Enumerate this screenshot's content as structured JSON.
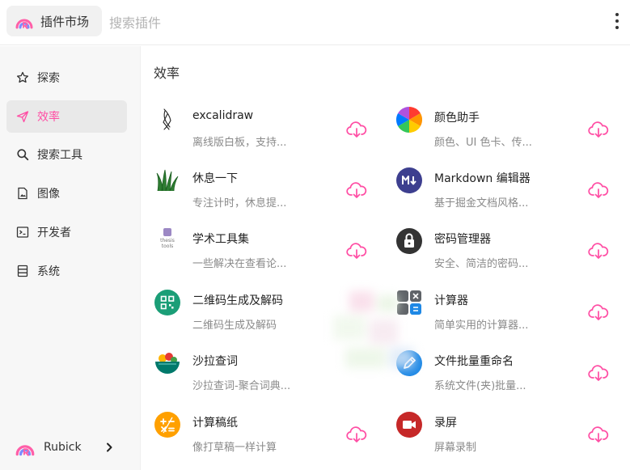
{
  "header": {
    "brand_label": "插件市场",
    "search_placeholder": "搜索插件"
  },
  "sidebar": {
    "items": [
      {
        "label": "探索",
        "icon": "star-icon"
      },
      {
        "label": "效率",
        "icon": "send-icon",
        "active": true
      },
      {
        "label": "搜索工具",
        "icon": "search-icon"
      },
      {
        "label": "图像",
        "icon": "image-file-icon"
      },
      {
        "label": "开发者",
        "icon": "terminal-icon"
      },
      {
        "label": "系统",
        "icon": "system-icon"
      }
    ],
    "user": {
      "name": "Rubick"
    }
  },
  "main": {
    "section_title": "效率",
    "plugins": [
      {
        "name": "excalidraw",
        "desc": "离线版白板，支持...",
        "icon": "excalidraw-icon"
      },
      {
        "name": "颜色助手",
        "desc": "颜色、UI 色卡、传...",
        "icon": "color-wheel-icon"
      },
      {
        "name": "休息一下",
        "desc": "专注计时，休息提...",
        "icon": "grass-icon"
      },
      {
        "name": "Markdown 编辑器",
        "desc": "基于掘金文档风格...",
        "icon": "markdown-icon"
      },
      {
        "name": "学术工具集",
        "desc": "一些解决在查看论...",
        "icon": "thesis-tools-icon",
        "icon_text_1": "thesis",
        "icon_text_2": "tools"
      },
      {
        "name": "密码管理器",
        "desc": "安全、简洁的密码...",
        "icon": "lock-icon"
      },
      {
        "name": "二维码生成及解码",
        "desc": "二维码生成及解码",
        "icon": "qrcode-icon"
      },
      {
        "name": "计算器",
        "desc": "简单实用的计算器...",
        "icon": "calculator-icon"
      },
      {
        "name": "沙拉查词",
        "desc": "沙拉查词-聚合词典...",
        "icon": "salad-bowl-icon"
      },
      {
        "name": "文件批量重命名",
        "desc": "系统文件(夹)批量...",
        "icon": "rename-pen-icon"
      },
      {
        "name": "计算稿纸",
        "desc": "像打草稿一样计算",
        "icon": "math-ops-icon"
      },
      {
        "name": "录屏",
        "desc": "屏幕录制",
        "icon": "record-camera-icon"
      }
    ]
  },
  "colors": {
    "accent": "#ff4ea4",
    "sidebar_bg": "#f7f7f7",
    "active_bg": "#e9e9e9"
  }
}
